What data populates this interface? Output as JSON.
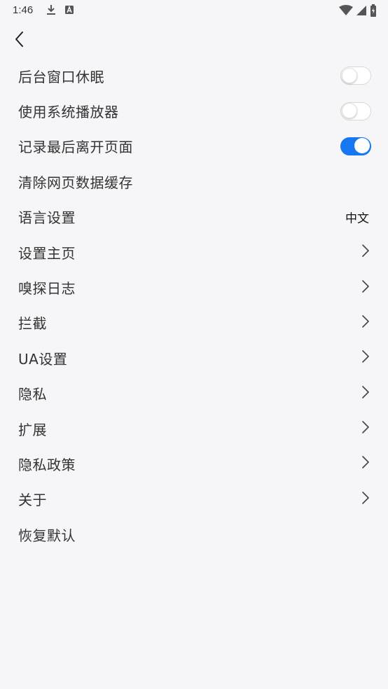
{
  "status_bar": {
    "time": "1:46",
    "left_icons": [
      "download-icon",
      "a-badge-icon"
    ],
    "right_icons": [
      "wifi-icon",
      "cell-signal-icon",
      "battery-icon"
    ]
  },
  "header": {
    "back_icon": "chevron-left-icon"
  },
  "settings": [
    {
      "label": "后台窗口休眠",
      "control": "toggle",
      "state": "off"
    },
    {
      "label": "使用系统播放器",
      "control": "toggle",
      "state": "off"
    },
    {
      "label": "记录最后离开页面",
      "control": "toggle",
      "state": "on"
    },
    {
      "label": "清除网页数据缓存",
      "control": "none"
    },
    {
      "label": "语言设置",
      "control": "value",
      "value": "中文"
    },
    {
      "label": "设置主页",
      "control": "chevron"
    },
    {
      "label": "嗅探日志",
      "control": "chevron"
    },
    {
      "label": "拦截",
      "control": "chevron"
    },
    {
      "label": "UA设置",
      "control": "chevron"
    },
    {
      "label": "隐私",
      "control": "chevron"
    },
    {
      "label": "扩展",
      "control": "chevron"
    },
    {
      "label": "隐私政策",
      "control": "chevron"
    },
    {
      "label": "关于",
      "control": "chevron"
    },
    {
      "label": "恢复默认",
      "control": "none"
    }
  ],
  "colors": {
    "accent": "#1677f0",
    "background": "#f6f6f8",
    "text": "#333333"
  }
}
